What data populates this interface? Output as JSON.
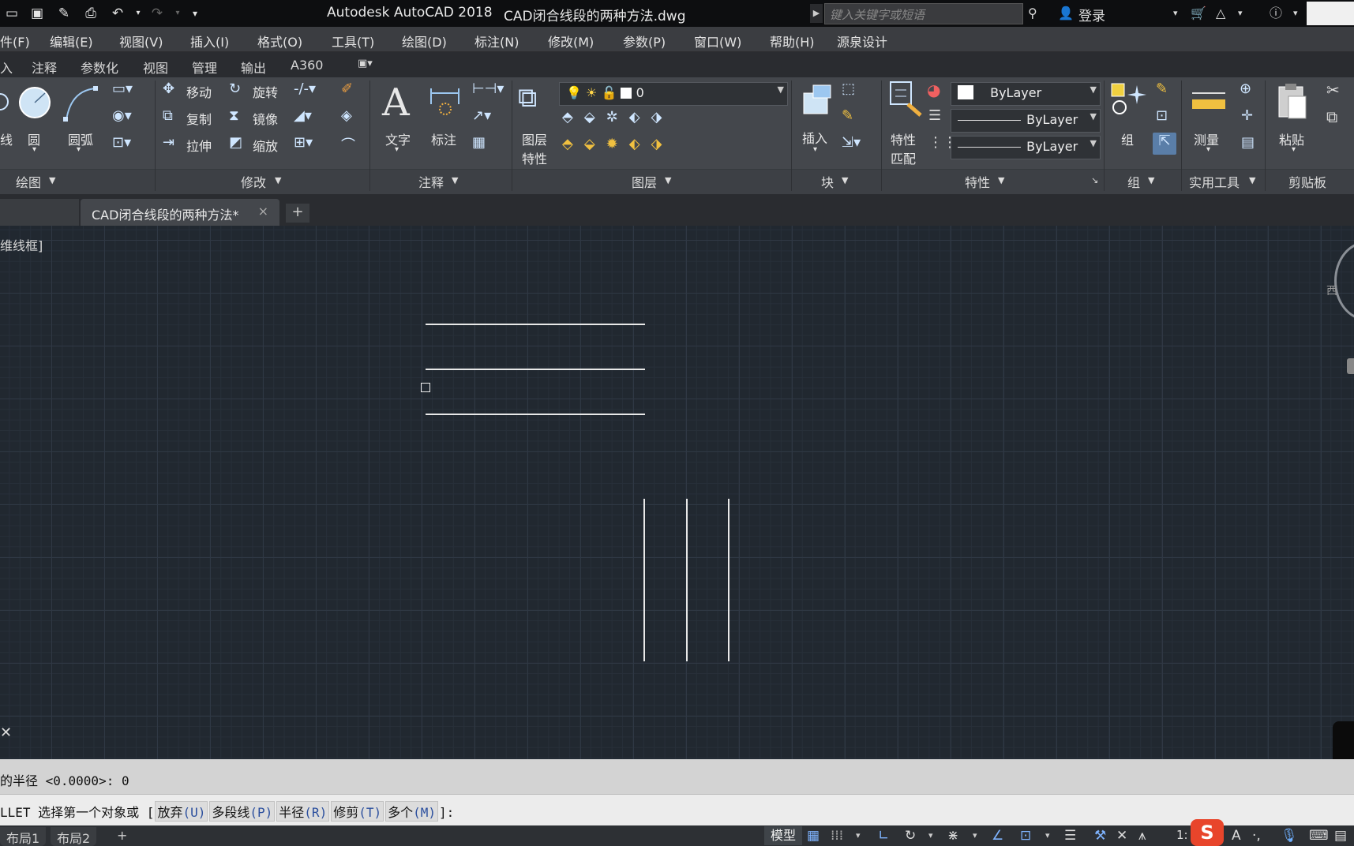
{
  "titlebar": {
    "app_title": "Autodesk AutoCAD 2018",
    "file_name": "CAD闭合线段的两种方法.dwg",
    "search_placeholder": "键入关键字或短语",
    "login": "登录"
  },
  "menu": {
    "items": [
      "件(F)",
      "编辑(E)",
      "视图(V)",
      "插入(I)",
      "格式(O)",
      "工具(T)",
      "绘图(D)",
      "标注(N)",
      "修改(M)",
      "参数(P)",
      "窗口(W)",
      "帮助(H)",
      "源泉设计"
    ]
  },
  "ribbon_tabs": [
    "入",
    "注释",
    "参数化",
    "视图",
    "管理",
    "输出",
    "A360"
  ],
  "ribbon": {
    "draw": {
      "title": "绘图",
      "line": "线",
      "circle": "圆",
      "arc": "圆弧"
    },
    "modify": {
      "title": "修改",
      "move": "移动",
      "rotate": "旋转",
      "copy": "复制",
      "mirror": "镜像",
      "stretch": "拉伸",
      "scale": "缩放"
    },
    "annotation": {
      "title": "注释",
      "text": "文字",
      "dimension": "标注"
    },
    "layers": {
      "title": "图层",
      "layer_props_1": "图层",
      "layer_props_2": "特性",
      "current_layer": "0"
    },
    "block": {
      "title": "块",
      "insert": "插入"
    },
    "properties": {
      "title": "特性",
      "match_1": "特性",
      "match_2": "匹配",
      "color": "ByLayer",
      "linetype": "ByLayer",
      "lineweight": "ByLayer"
    },
    "groups": {
      "title": "组",
      "group": "组"
    },
    "utilities": {
      "title": "实用工具",
      "measure": "测量"
    },
    "clipboard": {
      "title": "剪贴板",
      "paste": "粘贴"
    }
  },
  "doc_tabs": {
    "active": "CAD闭合线段的两种方法*",
    "close": "×",
    "add": "+"
  },
  "canvas": {
    "viewport_label": "维线框]",
    "viewcube_label": "西"
  },
  "command": {
    "history": "的半径 <0.0000>: 0",
    "prompt_prefix": "LLET 选择第一个对象或 [",
    "options": [
      {
        "label": "放弃",
        "key": "(U)"
      },
      {
        "label": "多段线",
        "key": "(P)"
      },
      {
        "label": "半径",
        "key": "(R)"
      },
      {
        "label": "修剪",
        "key": "(T)"
      },
      {
        "label": "多个",
        "key": "(M)"
      }
    ],
    "prompt_suffix": "]:"
  },
  "status": {
    "layout1": "布局1",
    "layout2": "布局2",
    "add": "+",
    "model": "模型",
    "scale": "1:"
  },
  "colors": {
    "canvas_bg": "#212830",
    "line": "#e8e8e8",
    "ribbon_bg": "#44474c"
  }
}
